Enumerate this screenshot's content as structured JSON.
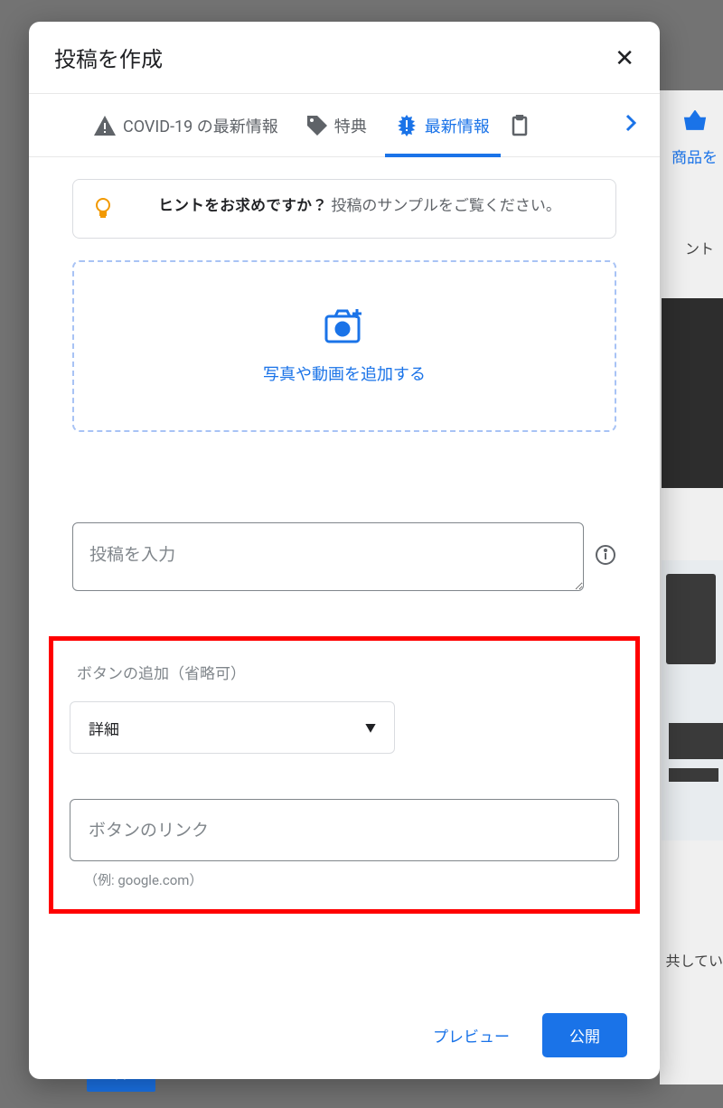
{
  "background": {
    "sidebar_link": "商品を",
    "sidebar_text1": "ント",
    "sidebar_text2": "共してい",
    "button": "詳細"
  },
  "modal": {
    "title": "投稿を作成",
    "tabs": {
      "covid": "COVID-19 の最新情報",
      "offers": "特典",
      "updates": "最新情報"
    },
    "tip": {
      "strong": "ヒントをお求めですか？",
      "rest": "投稿のサンプルをご覧ください。"
    },
    "upload": {
      "label": "写真や動画を追加する"
    },
    "post_input": {
      "placeholder": "投稿を入力"
    },
    "button_section": {
      "label": "ボタンの追加（省略可）",
      "select_value": "詳細",
      "link_placeholder": "ボタンのリンク",
      "link_hint": "（例: google.com）"
    },
    "footer": {
      "preview": "プレビュー",
      "publish": "公開"
    }
  }
}
